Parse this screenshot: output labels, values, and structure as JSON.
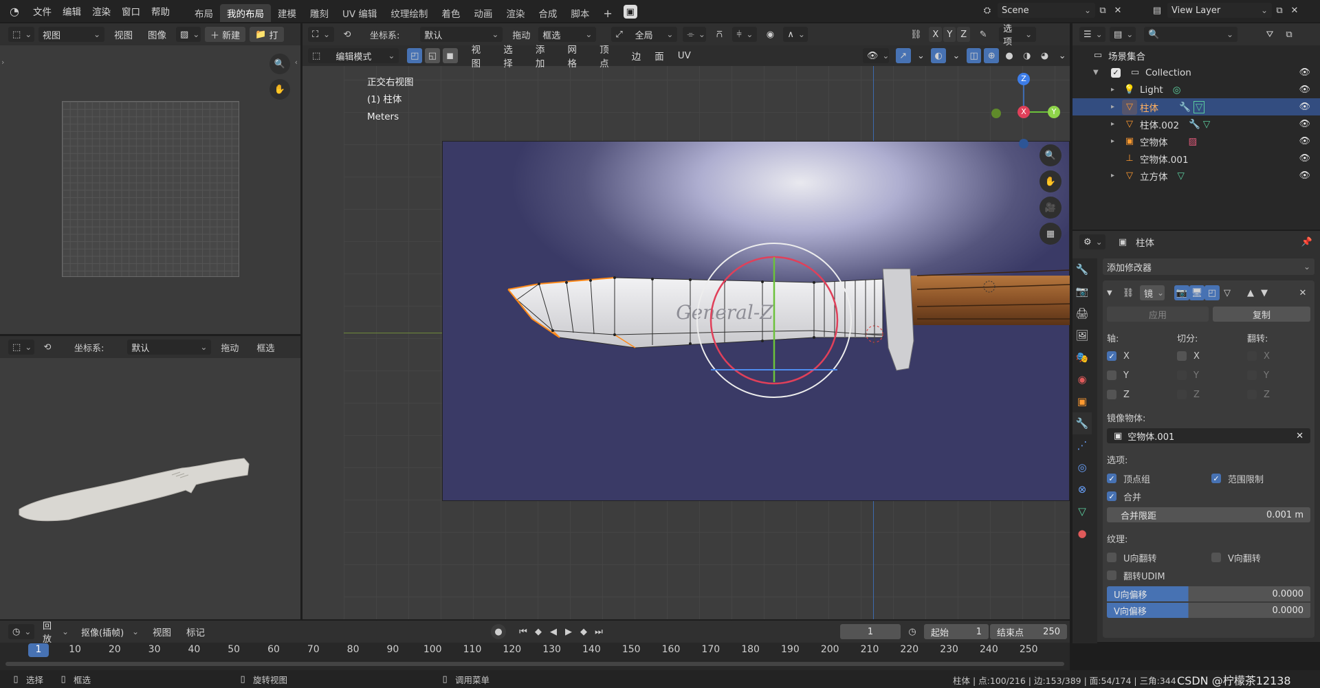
{
  "topbar": {
    "menus": [
      "文件",
      "编辑",
      "渲染",
      "窗口",
      "帮助"
    ],
    "workspaces": [
      "布局",
      "我的布局",
      "建模",
      "雕刻",
      "UV 编辑",
      "纹理绘制",
      "着色",
      "动画",
      "渲染",
      "合成",
      "脚本"
    ],
    "active_workspace": "我的布局",
    "scene": "Scene",
    "view_layer": "View Layer"
  },
  "image_editor": {
    "view_mode": "视图",
    "menus": [
      "视图",
      "图像"
    ],
    "new_label": "新建",
    "open_label": "打"
  },
  "preview3d": {
    "coord_label": "坐标系:",
    "coord_value": "默认",
    "drag_label": "拖动",
    "select_label": "框选"
  },
  "viewport": {
    "coord_label": "坐标系:",
    "coord_value": "默认",
    "drag_label": "拖动",
    "select_mode": "框选",
    "pivot": "全局",
    "axes": [
      "X",
      "Y",
      "Z"
    ],
    "options_label": "选项",
    "mode": "编辑模式",
    "menus": [
      "视图",
      "选择",
      "添加",
      "网格",
      "顶点",
      "边",
      "面",
      "UV"
    ],
    "overlay_text": [
      "正交右视图",
      "(1) 柱体",
      "Meters"
    ],
    "engraving": "General-Z",
    "gizmo": {
      "x": "X",
      "y": "Y",
      "z": "Z"
    }
  },
  "outliner": {
    "root": "场景集合",
    "collection": "Collection",
    "items": [
      {
        "name": "Light",
        "icon": "light-icon",
        "selected": false
      },
      {
        "name": "柱体",
        "icon": "mesh-icon",
        "selected": true
      },
      {
        "name": "柱体.002",
        "icon": "mesh-icon",
        "selected": false
      },
      {
        "name": "空物体",
        "icon": "image-empty-icon",
        "selected": false
      },
      {
        "name": "空物体.001",
        "icon": "empty-axes-icon",
        "selected": false
      },
      {
        "name": "立方体",
        "icon": "mesh-icon",
        "selected": false
      }
    ]
  },
  "properties": {
    "object_name": "柱体",
    "add_modifier": "添加修改器",
    "modifier_name": "镜",
    "apply_label": "应用",
    "copy_label": "复制",
    "axis_label": "轴:",
    "bisect_label": "切分:",
    "flip_label": "翻转:",
    "axes": [
      "X",
      "Y",
      "Z"
    ],
    "axis_checked": [
      true,
      false,
      false
    ],
    "mirror_object_label": "镜像物体:",
    "mirror_object": "空物体.001",
    "options_label": "选项:",
    "vertex_groups": "顶点组",
    "clipping": "范围限制",
    "merge": "合并",
    "merge_distance_label": "合并限距",
    "merge_distance": "0.001 m",
    "texture_label": "纹理:",
    "u_flip": "U向翻转",
    "v_flip": "V向翻转",
    "udim_flip": "翻转UDIM",
    "u_offset_label": "U向偏移",
    "u_offset": "0.0000",
    "v_offset_label": "V向偏移",
    "v_offset": "0.0000"
  },
  "timeline": {
    "playback": "回放",
    "keying": "抠像(插帧)",
    "menus": [
      "视图",
      "标记"
    ],
    "current_frame": "1",
    "start_label": "起始",
    "start": "1",
    "end_label": "结束点",
    "end": "250",
    "ticks": [
      "1",
      "10",
      "20",
      "30",
      "40",
      "50",
      "60",
      "70",
      "80",
      "90",
      "100",
      "110",
      "120",
      "130",
      "140",
      "150",
      "160",
      "170",
      "180",
      "190",
      "200",
      "210",
      "220",
      "230",
      "240",
      "250"
    ]
  },
  "statusbar": {
    "select": "选择",
    "box_select": "框选",
    "rotate_view": "旋转视图",
    "context_menu": "调用菜单",
    "stats": "柱体 | 点:100/216 | 边:153/389 | 面:54/174 | 三角:344",
    "watermark": "CSDN @柠檬茶12138"
  },
  "colors": {
    "accent": "#4772b3",
    "header": "#303030",
    "background": "#1d1d1d",
    "viewport": "#3d3d3d",
    "outline_selected": "#ff8a1a"
  }
}
